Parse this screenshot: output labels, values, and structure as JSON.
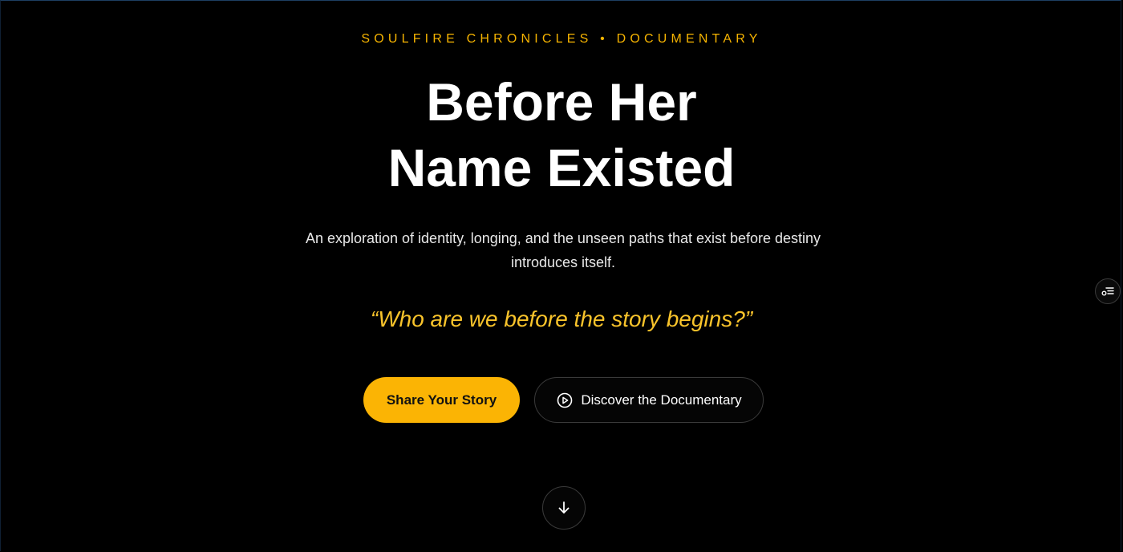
{
  "hero": {
    "eyebrow": "SOULFIRE CHRONICLES • DOCUMENTARY",
    "title_line1": "Before Her",
    "title_line2": "Name Existed",
    "subtitle": "An exploration of identity, longing, and the unseen paths that exist before destiny introduces itself.",
    "quote": "“Who are we before the story begins?”",
    "primary_button": "Share Your Story",
    "secondary_button": "Discover the Documentary",
    "secondary_button_icon": "play-circle-icon",
    "scroll_icon": "arrow-down-icon"
  },
  "side_panel": {
    "icon": "filter-list-icon"
  },
  "colors": {
    "accent": "#fbb404",
    "eyebrow": "#f5b301",
    "quote": "#f9c42b",
    "background": "#000000",
    "text": "#ffffff"
  }
}
